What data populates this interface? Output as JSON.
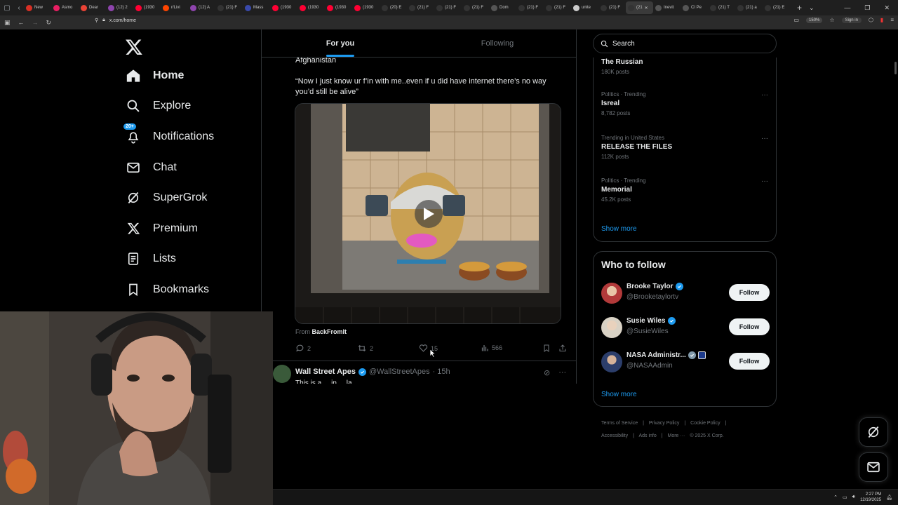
{
  "browser": {
    "tabs": [
      {
        "label": "New",
        "color": "#d93025"
      },
      {
        "label": "Asmo",
        "color": "#e91e63"
      },
      {
        "label": "Dear",
        "color": "#ea4335"
      },
      {
        "label": "(12) 2",
        "color": "#8e44ad"
      },
      {
        "label": "(1930",
        "color": "#ff0033"
      },
      {
        "label": "r/Livi",
        "color": "#ff4500"
      },
      {
        "label": "(12) A",
        "color": "#8e44ad"
      },
      {
        "label": "(21) F",
        "color": "#333333"
      },
      {
        "label": "Mass",
        "color": "#3949ab"
      },
      {
        "label": "(1930",
        "color": "#ff0033"
      },
      {
        "label": "(1930",
        "color": "#ff0033"
      },
      {
        "label": "(1930",
        "color": "#ff0033"
      },
      {
        "label": "(1930",
        "color": "#ff0033"
      },
      {
        "label": "(20) E",
        "color": "#333333"
      },
      {
        "label": "(21) F",
        "color": "#333333"
      },
      {
        "label": "(21) F",
        "color": "#333333"
      },
      {
        "label": "(21) F",
        "color": "#333333"
      },
      {
        "label": "Dom",
        "color": "#555555"
      },
      {
        "label": "(21) F",
        "color": "#333333"
      },
      {
        "label": "(21) F",
        "color": "#333333"
      },
      {
        "label": "unite",
        "color": "#cccccc"
      },
      {
        "label": "(21) F",
        "color": "#333333"
      },
      {
        "label": "(21",
        "color": "#333333",
        "active": true
      },
      {
        "label": "Inevit",
        "color": "#555555"
      },
      {
        "label": "CI Pe",
        "color": "#555555"
      },
      {
        "label": "(21) T",
        "color": "#333333"
      },
      {
        "label": "(21) a",
        "color": "#333333"
      },
      {
        "label": "(21) E",
        "color": "#333333"
      }
    ],
    "url": "x.com/home",
    "zoom": "150%",
    "signin": "Sign in"
  },
  "nav": {
    "items": [
      {
        "label": "Home",
        "icon": "home-icon",
        "active": true
      },
      {
        "label": "Explore",
        "icon": "search-icon"
      },
      {
        "label": "Notifications",
        "icon": "bell-icon",
        "badge": "20+"
      },
      {
        "label": "Chat",
        "icon": "mail-icon"
      },
      {
        "label": "SuperGrok",
        "icon": "grok-icon"
      },
      {
        "label": "Premium",
        "icon": "x-icon"
      },
      {
        "label": "Lists",
        "icon": "list-icon"
      },
      {
        "label": "Bookmarks",
        "icon": "bookmark-icon"
      }
    ]
  },
  "feed": {
    "tabs": [
      "For you",
      "Following"
    ],
    "tweet": {
      "text_top": "Afghanistan",
      "text_quote": "“Now I just know ur f’in with me..even if u did have internet there’s no way you’d still be alive”",
      "from_label": "From",
      "from_source": "BackFromIt",
      "replies": "2",
      "reposts": "2",
      "likes": "15",
      "views": "566"
    },
    "next_tweet": {
      "name": "Wall Street Apes",
      "handle": "@WallStreetApes",
      "time": "· 15h",
      "snippet": "This is a ... in ... la..."
    }
  },
  "right": {
    "search_placeholder": "Search",
    "trends": [
      {
        "meta": "",
        "title": "The Russian",
        "posts": "180K posts"
      },
      {
        "meta": "Politics · Trending",
        "title": "Isreal",
        "posts": "8,782 posts"
      },
      {
        "meta": "Trending in United States",
        "title": "RELEASE THE FILES",
        "posts": "112K posts"
      },
      {
        "meta": "Politics · Trending",
        "title": "Memorial",
        "posts": "45.2K posts"
      }
    ],
    "trends_show_more": "Show more",
    "who_to_follow": {
      "title": "Who to follow",
      "people": [
        {
          "name": "Brooke Taylor",
          "handle": "@Brooketaylortv",
          "follow": "Follow",
          "avatar_color": "#b23a3a"
        },
        {
          "name": "Susie Wiles",
          "handle": "@SusieWiles",
          "follow": "Follow",
          "avatar_color": "#d9d2c5"
        },
        {
          "name": "NASA Administr...",
          "handle": "@NASAAdmin",
          "follow": "Follow",
          "avatar_color": "#2c3e6b"
        }
      ],
      "show_more": "Show more"
    },
    "footer": [
      "Terms of Service",
      "|",
      "Privacy Policy",
      "|",
      "Cookie Policy",
      "|",
      "Accessibility",
      "|",
      "Ads info",
      "|",
      "More ···",
      "© 2025 X Corp."
    ]
  },
  "taskbar": {
    "time": "2:27 PM",
    "date": "12/19/2025"
  },
  "colors": {
    "accent": "#1d9bf0",
    "border": "#2f3336",
    "muted": "#71767b"
  }
}
